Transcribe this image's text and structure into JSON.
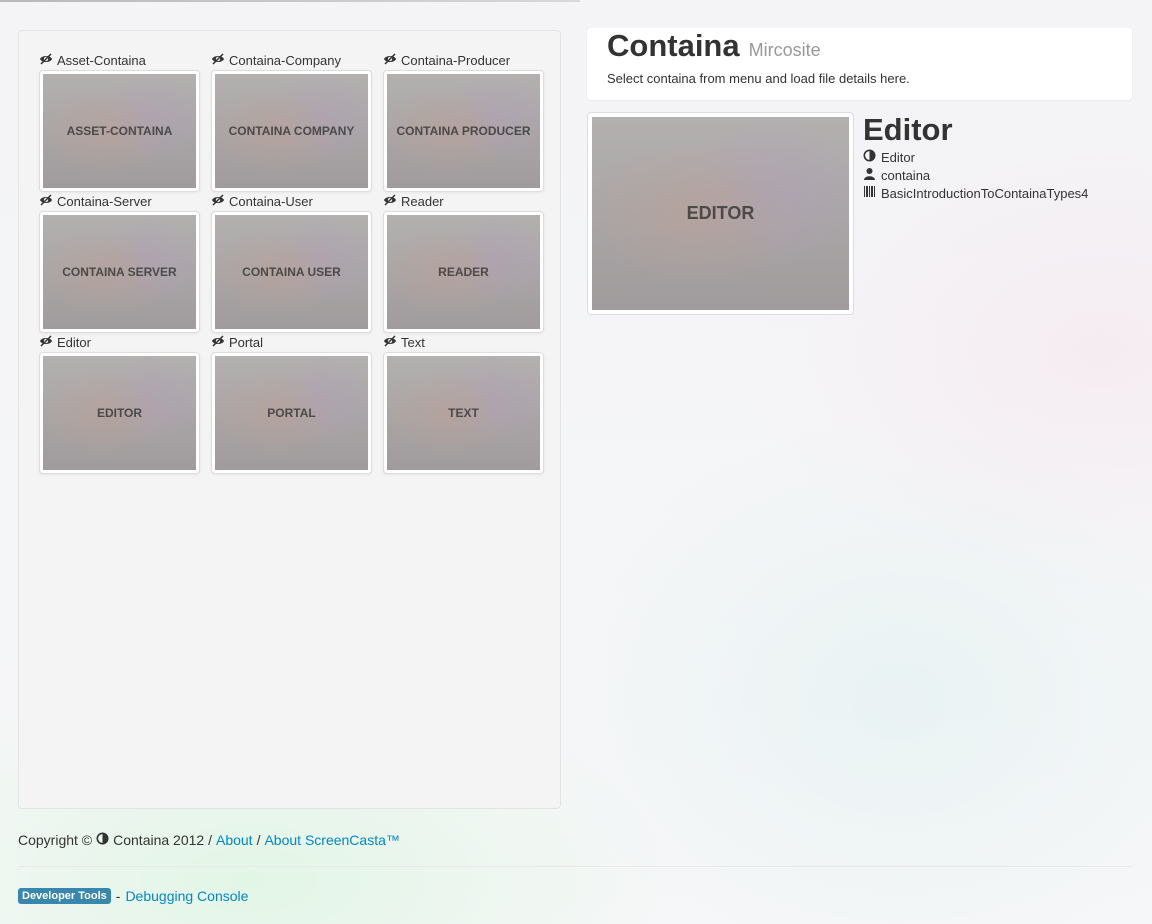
{
  "tiles": [
    {
      "title": "Asset-Containa",
      "thumb_text": "ASSET-CONTAINA"
    },
    {
      "title": "Containa-Company",
      "thumb_text": "CONTAINA COMPANY"
    },
    {
      "title": "Containa-Producer",
      "thumb_text": "CONTAINA PRODUCER"
    },
    {
      "title": "Containa-Server",
      "thumb_text": "CONTAINA SERVER"
    },
    {
      "title": "Containa-User",
      "thumb_text": "CONTAINA USER"
    },
    {
      "title": "Reader",
      "thumb_text": "READER"
    },
    {
      "title": "Editor",
      "thumb_text": "EDITOR"
    },
    {
      "title": "Portal",
      "thumb_text": "PORTAL"
    },
    {
      "title": "Text",
      "thumb_text": "TEXT"
    }
  ],
  "hero": {
    "title": "Containa",
    "subtitle": "Mircosite",
    "description": "Select containa from menu and load file details here."
  },
  "detail": {
    "thumb_text": "EDITOR",
    "title": "Editor",
    "type": "Editor",
    "owner": "containa",
    "file": "BasicIntroductionToContainaTypes4"
  },
  "footer": {
    "copyright": "Copyright ©",
    "brand": "Containa 2012 /",
    "about": "About",
    "sep": "/",
    "about_screencasta": "About ScreenCasta™",
    "dev_label": "Developer Tools",
    "dev_sep": "-",
    "debug_link": "Debugging Console"
  },
  "colors": {
    "link": "#0088cc",
    "dev_label_bg": "#3a87ad"
  }
}
